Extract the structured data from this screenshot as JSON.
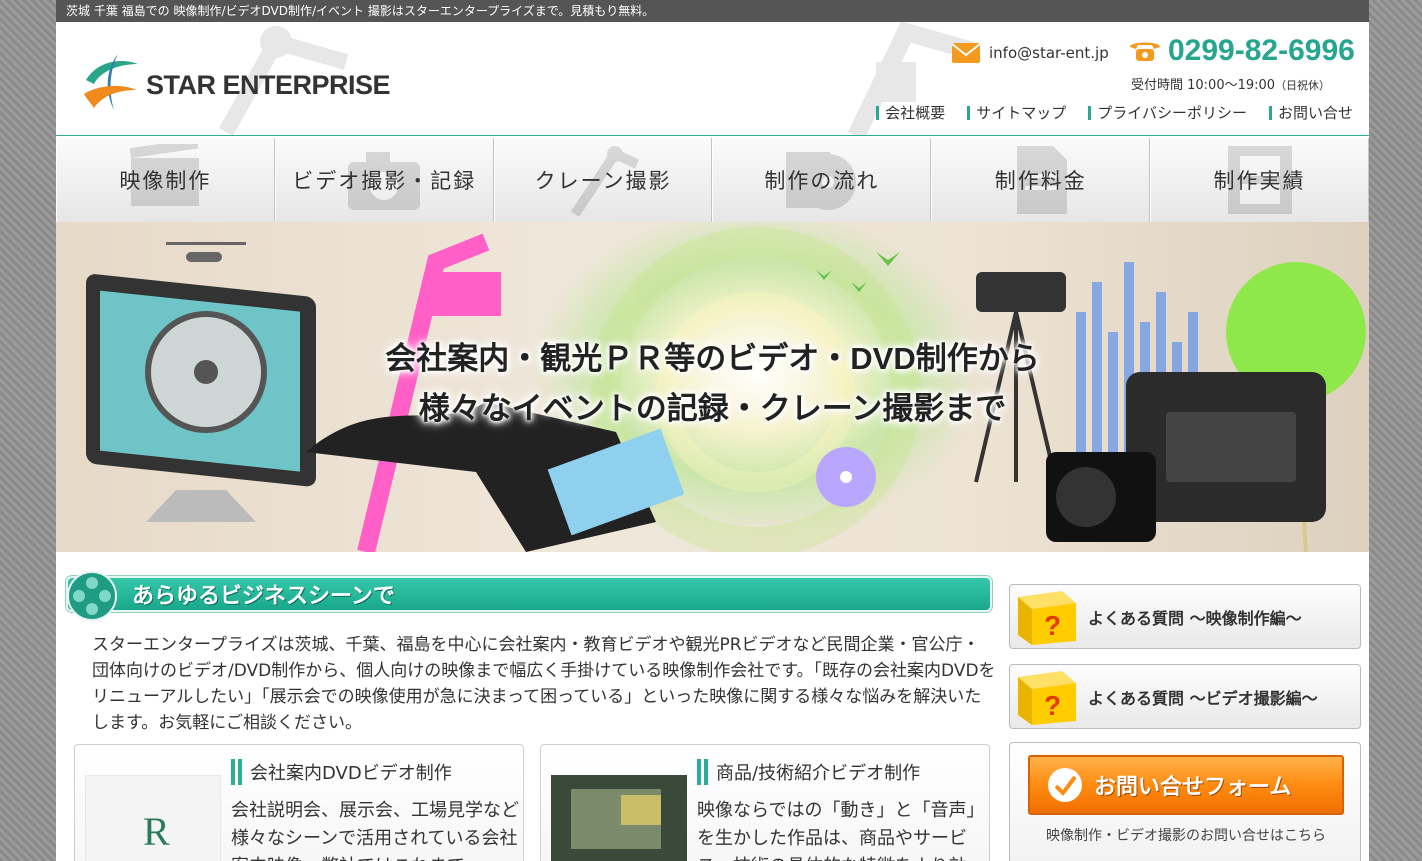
{
  "topbar": {
    "tagline": "茨城 千葉 福島での 映像制作/ビデオDVD制作/イベント 撮影はスターエンタープライズまで。見積もり無料。"
  },
  "header": {
    "logo_text": "STAR ENTERPRISE",
    "email": "info@star-ent.jp",
    "phone": "0299-82-6996",
    "hours": "受付時間 10:00〜19:00",
    "hours_note": "（日祝休）",
    "util_nav": [
      "会社概要",
      "サイトマップ",
      "プライバシーポリシー",
      "お問い合せ"
    ]
  },
  "global_nav": [
    {
      "label": "映像制作",
      "icon": "film-icon"
    },
    {
      "label": "ビデオ撮影・記録",
      "icon": "camera-icon"
    },
    {
      "label": "クレーン撮影",
      "icon": "crane-icon"
    },
    {
      "label": "制作の流れ",
      "icon": "disc-icon"
    },
    {
      "label": "制作料金",
      "icon": "document-icon"
    },
    {
      "label": "制作実績",
      "icon": "filmstrip-icon"
    }
  ],
  "hero": {
    "line1": "会社案内・観光ＰＲ等のビデオ・DVD制作から",
    "line2": "様々なイベントの記録・クレーン撮影まで"
  },
  "section": {
    "title": "あらゆるビジネスシーンで",
    "intro": "スターエンタープライズは茨城、千葉、福島を中心に会社案内・教育ビデオや観光PRビデオなど民間企業・官公庁・団体向けのビデオ/DVD制作から、個人向けの映像まで幅広く手掛けている映像制作会社です。「既存の会社案内DVDをリニューアルしたい」「展示会での映像使用が急に決まって困っている」といった映像に関する様々な悩みを解決いたします。お気軽にご相談ください。"
  },
  "cards": [
    {
      "title": "会社案内DVDビデオ制作",
      "text": "会社説明会、展示会、工場見学など様々なシーンで活用されている会社案内映像。弊社ではこれまで"
    },
    {
      "title": "商品/技術紹介ビデオ制作",
      "text": "映像ならではの「動き」と「音声」を生かした作品は、商品やサービス・技術の具体的な特徴をより効"
    }
  ],
  "sidebar": {
    "faq": [
      "よくある質問 〜映像制作編〜",
      "よくある質問 〜ビデオ撮影編〜"
    ],
    "contact_button": "お問い合せフォーム",
    "contact_note": "映像制作・ビデオ撮影のお問い合せはこちら"
  },
  "colors": {
    "accent": "#2aaf96",
    "phone": "#27a58f",
    "contact": "#ff8c12"
  }
}
